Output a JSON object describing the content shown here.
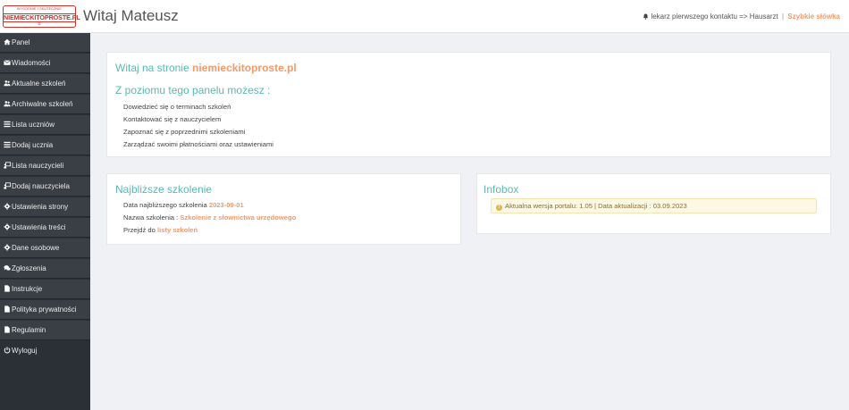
{
  "logo": {
    "tagline": "WYGODNIE I SKUTECZNIE",
    "brand": "NIEMIECKITOPROSTE.PL",
    "mark": "②"
  },
  "header": {
    "welcome": "Witaj Mateusz",
    "term": "lekarz pierwszego kontaktu => Hausarzt",
    "separator": "|",
    "quick_words": "Szybkie słówka"
  },
  "sidebar": {
    "items": [
      {
        "label": "Panel",
        "icon": "home-icon"
      },
      {
        "label": "Wiadomości",
        "icon": "envelope-icon"
      },
      {
        "label": "Aktualne szkoleń",
        "icon": "users-icon"
      },
      {
        "label": "Archiwalne szkoleń",
        "icon": "users-icon"
      },
      {
        "label": "Lista uczniów",
        "icon": "list-icon"
      },
      {
        "label": "Dodaj ucznia",
        "icon": "list-icon"
      },
      {
        "label": "Lista nauczycieli",
        "icon": "teacher-icon"
      },
      {
        "label": "Dodaj nauczyciela",
        "icon": "teacher-icon"
      },
      {
        "label": "Ustawienia strony",
        "icon": "gear-icon"
      },
      {
        "label": "Ustawienia treści",
        "icon": "gear-icon"
      },
      {
        "label": "Dane osobowe",
        "icon": "gear-icon"
      },
      {
        "label": "Zgłoszenia",
        "icon": "comments-icon"
      },
      {
        "label": "Instrukcje",
        "icon": "file-icon"
      },
      {
        "label": "Polityka prywatności",
        "icon": "file-icon"
      },
      {
        "label": "Regulamin",
        "icon": "file-icon"
      },
      {
        "label": "Wyloguj",
        "icon": "power-icon"
      }
    ]
  },
  "welcome_panel": {
    "title_prefix": "Witaj na stronie",
    "title_site": "niemieckitoproste.pl",
    "subtitle": "Z poziomu tego panelu możesz :",
    "items": [
      "Dowiedzieć się o terminach szkoleń",
      "Kontaktować się z nauczycielem",
      "Zapoznać się z poprzednimi szkoleniami",
      "Zarządzać swoimi płatnościami oraz ustawieniami"
    ]
  },
  "training_panel": {
    "title": "Najbliższe szkolenie",
    "date_label": "Data najbliższego szkolenia",
    "date_value": "2023-09-01",
    "name_label": "Nazwa szkolenia :",
    "name_value": "Szkolenie z słownictwa urzędowego",
    "goto_label": "Przejdź do",
    "goto_link": "listy szkoleń"
  },
  "infobox": {
    "title": "Infobox",
    "alert": "Aktualna wersja portalu: 1.05 | Data aktualizacji : 03.09.2023"
  },
  "colors": {
    "accent": "#f39a6b",
    "teal": "#5bb8b1",
    "sidebar": "#2b3036",
    "brand": "#c9302c"
  }
}
